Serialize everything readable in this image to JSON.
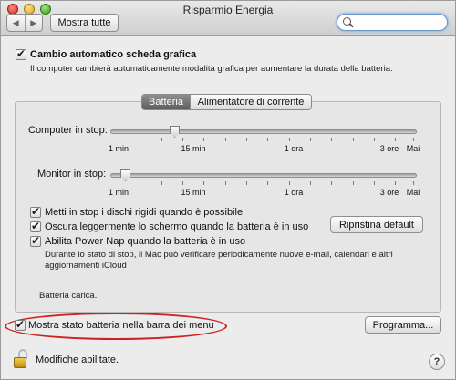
{
  "window": {
    "title": "Risparmio Energia"
  },
  "toolbar": {
    "back_icon": "chevron-left-icon",
    "forward_icon": "chevron-right-icon",
    "show_all_label": "Mostra tutte",
    "search": {
      "value": "",
      "placeholder": ""
    }
  },
  "graphics_switching": {
    "label": "Cambio automatico scheda grafica",
    "checked": true,
    "description": "Il computer cambierà automaticamente modalità grafica per aumentare la durata della batteria."
  },
  "tabs": [
    {
      "label": "Batteria",
      "active": true
    },
    {
      "label": "Alimentatore di corrente",
      "active": false
    }
  ],
  "computer_sleep": {
    "label": "Computer in stop:",
    "selected": "15 min"
  },
  "display_sleep": {
    "label": "Monitor in stop:",
    "selected": "1 min"
  },
  "slider_tick_labels": [
    "1 min",
    "15 min",
    "1 ora",
    "3 ore",
    "Mai"
  ],
  "options": [
    {
      "label": "Metti in stop i dischi rigidi quando è possibile",
      "checked": true
    },
    {
      "label": "Oscura leggermente lo schermo quando la batteria è in uso",
      "checked": true
    },
    {
      "label": "Abilita Power Nap quando la batteria è in uso",
      "checked": true
    }
  ],
  "power_nap_description_line1": "Durante lo stato di stop, il Mac può verificare periodicamente nuove e-mail, calendari e altri",
  "power_nap_description_line2": "aggiornamenti iCloud",
  "restore_defaults_label": "Ripristina default",
  "battery_status": "Batteria carica.",
  "menu_bar_option": {
    "label": "Mostra stato batteria nella barra dei menu",
    "checked": true
  },
  "schedule_label": "Programma...",
  "lock_label": "Modifiche abilitate.",
  "help_label": "?",
  "colors": {
    "highlight_ellipse": "#cc2222",
    "lock": "#e0a820"
  }
}
